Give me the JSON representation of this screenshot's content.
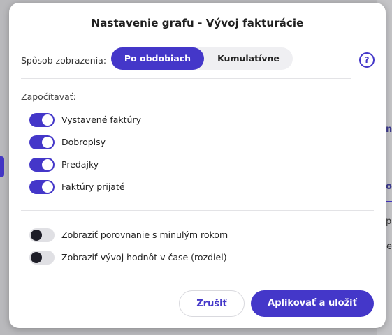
{
  "background": {
    "right_marks": [
      "n",
      "o",
      "po",
      "e"
    ]
  },
  "dialog": {
    "title": "Nastavenie grafu - Vývoj fakturácie",
    "mode": {
      "label": "Spôsob zobrazenia:",
      "options": [
        "Po obdobiach",
        "Kumulatívne"
      ],
      "selected": "Po obdobiach"
    },
    "help_icon": "?",
    "include": {
      "label": "Započítavať:",
      "items": [
        {
          "label": "Vystavené faktúry",
          "on": true
        },
        {
          "label": "Dobropisy",
          "on": true
        },
        {
          "label": "Predajky",
          "on": true
        },
        {
          "label": "Faktúry prijaté",
          "on": true
        }
      ]
    },
    "extra_options": [
      {
        "label": "Zobraziť porovnanie s minulým rokom",
        "on": false
      },
      {
        "label": "Zobraziť vývoj hodnôt v čase (rozdiel)",
        "on": false
      }
    ],
    "buttons": {
      "cancel": "Zrušiť",
      "apply": "Aplikovať a uložiť"
    },
    "colors": {
      "accent": "#4437c9",
      "toggle_off": "#e0e0e4",
      "overlay": "#b9b9bc"
    }
  }
}
